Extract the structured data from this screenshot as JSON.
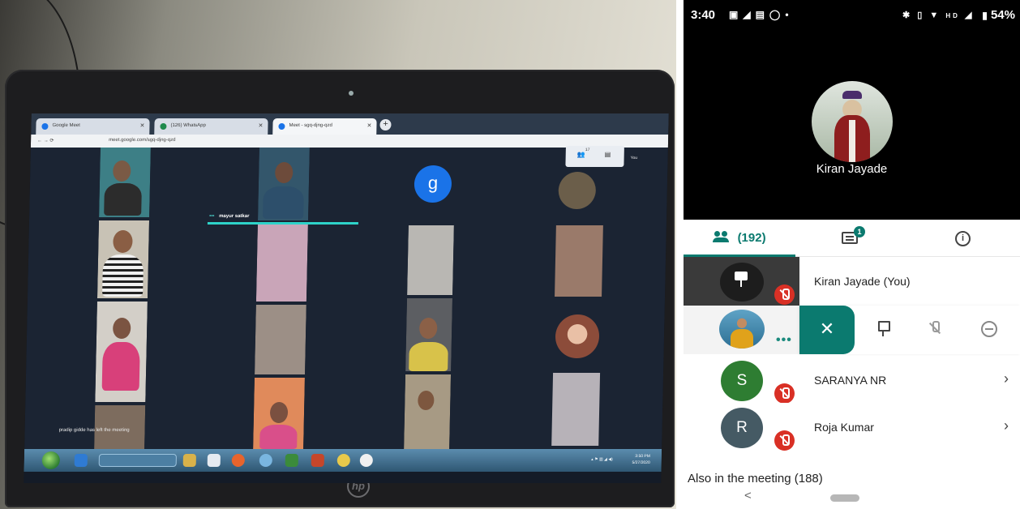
{
  "photo": {
    "browser": {
      "tabs": [
        {
          "label": "Google Meet"
        },
        {
          "label": "(126) WhatsApp"
        },
        {
          "label": "Meet - sgq-djng-qzd"
        }
      ],
      "address": "meet.google.com/sgq-djng-qzd"
    },
    "meet": {
      "active_speaker": "mayur satkar",
      "avatar_letter": "g",
      "participants_count": "17",
      "self_label": "You",
      "notification": "pradip gidde has left the meeting"
    },
    "taskbar": {
      "time": "3:50 PM",
      "date": "5/27/2020"
    }
  },
  "phone": {
    "statusbar": {
      "time": "3:40",
      "battery": "54%",
      "network": "HD"
    },
    "caller_name": "Kiran Jayade",
    "tabs": {
      "people_count": "(192)",
      "chat_badge": "1"
    },
    "participants": [
      {
        "name": "Kiran Jayade (You)"
      },
      {
        "name": "SARANYA NR",
        "initial": "S",
        "color": "#2e7d32"
      },
      {
        "name": "Roja Kumar",
        "initial": "R",
        "color": "#455a64"
      }
    ],
    "also_in_meeting": "Also in the meeting (188)",
    "colors": {
      "accent": "#0b7a6f",
      "muted": "#d93025"
    }
  }
}
